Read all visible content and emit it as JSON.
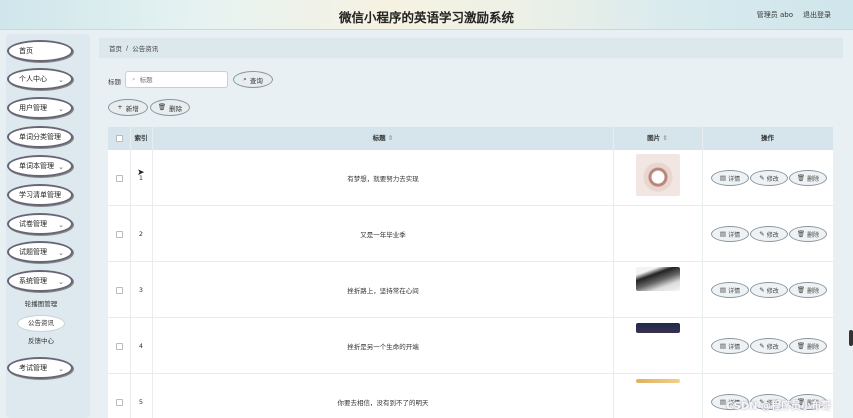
{
  "header": {
    "title": "微信小程序的英语学习激励系统",
    "user_label": "管理员 abo",
    "logout_label": "退出登录"
  },
  "sidebar": {
    "items": [
      {
        "label": "首页",
        "has_chevron": false
      },
      {
        "label": "个人中心",
        "has_chevron": true
      },
      {
        "label": "用户管理",
        "has_chevron": true
      },
      {
        "label": "单词分类管理",
        "has_chevron": false
      },
      {
        "label": "单词本管理",
        "has_chevron": true
      },
      {
        "label": "学习清单管理",
        "has_chevron": false
      },
      {
        "label": "试卷管理",
        "has_chevron": true
      },
      {
        "label": "试题管理",
        "has_chevron": true
      },
      {
        "label": "系统管理",
        "has_chevron": true
      },
      {
        "label": "考试管理",
        "has_chevron": true
      }
    ],
    "sub_items": [
      {
        "label": "轮播图管理",
        "active": false
      },
      {
        "label": "公告资讯",
        "active": true
      },
      {
        "label": "反馈中心",
        "active": false
      }
    ]
  },
  "breadcrumb": {
    "home": "首页",
    "sep": "/",
    "current": "公告资讯"
  },
  "search": {
    "label": "标题",
    "placeholder": "标题",
    "button": "查询"
  },
  "toolbar": {
    "add": "新增",
    "delete": "删除"
  },
  "table": {
    "headers": {
      "index": "索引",
      "title": "标题",
      "image": "图片",
      "actions": "操作"
    },
    "sort_icon": "⇕",
    "rows": [
      {
        "index": "1",
        "title": "有梦想，就要努力去实现",
        "image": "photo-flower"
      },
      {
        "index": "2",
        "title": "又是一年毕业季",
        "image": ""
      },
      {
        "index": "3",
        "title": "挫折路上，坚持常在心间",
        "image": "photo-dark"
      },
      {
        "index": "4",
        "title": "挫折是另一个生命的开端",
        "image": "photo-night"
      },
      {
        "index": "5",
        "title": "你要去相信，没有到不了的明天",
        "image": "photo-orange"
      }
    ],
    "row_actions": {
      "detail": "详情",
      "edit": "修改",
      "delete": "删除"
    }
  },
  "watermark": "CSDN @程序员小布哥",
  "colors": {
    "header_bg": "#e7f3f1",
    "table_head": "#d6e5eb",
    "sidebar_bg": "#dde9ee"
  }
}
